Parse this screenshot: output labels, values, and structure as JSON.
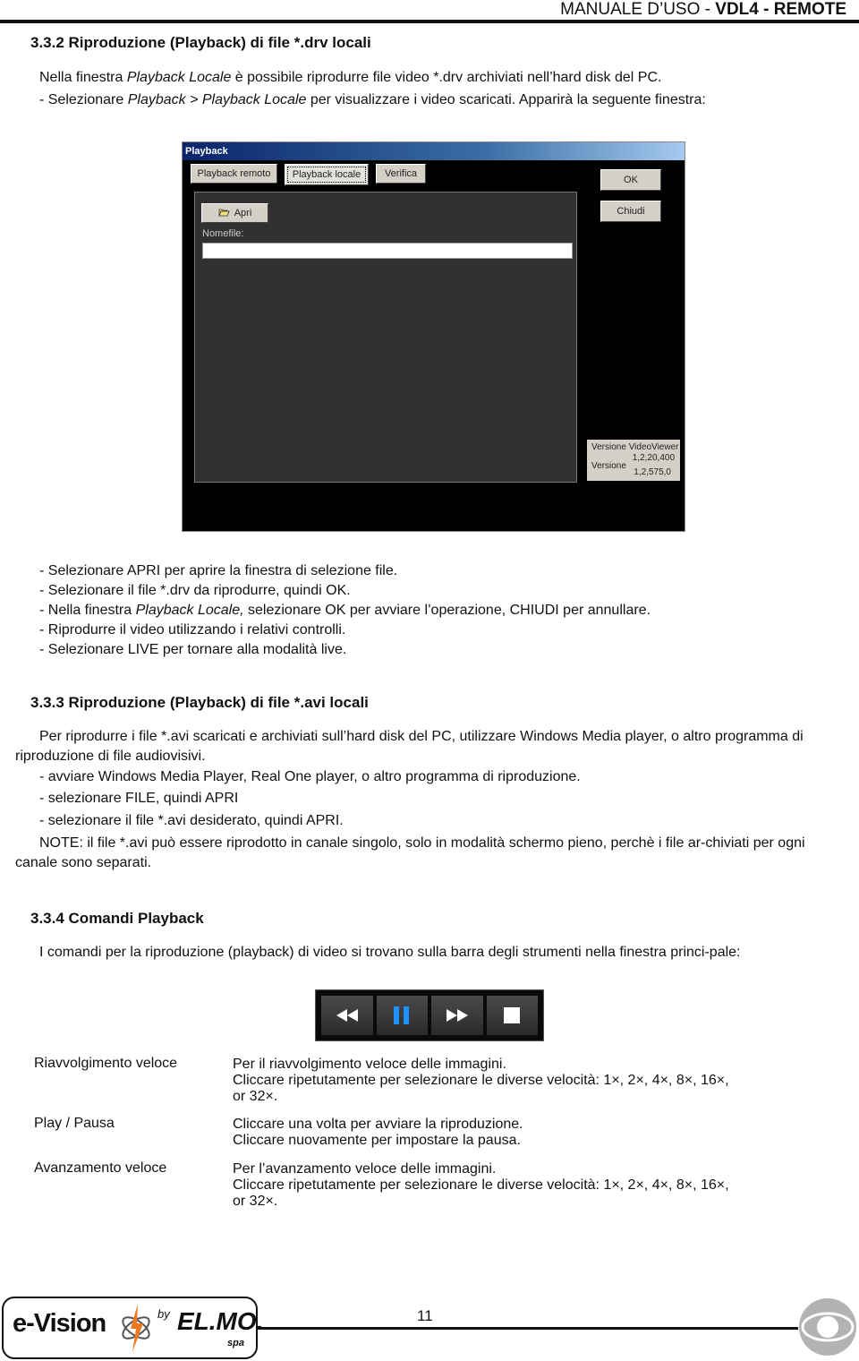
{
  "header": {
    "manual": "MANUALE D’USO  - ",
    "product": "VDL4 - REMOTE"
  },
  "section_332": {
    "title": "3.3.2 Riproduzione (Playback) di file *.drv locali",
    "intro_pre": "Nella finestra ",
    "intro_italic": "Playback Locale",
    "intro_post": " è possibile riprodurre file video *.drv archiviati nell’hard disk del PC.",
    "step_pre": "-  Selezionare ",
    "step_italic": "Playback > Playback Locale",
    "step_post": " per visualizzare i video scaricati. Apparirà la seguente finestra:",
    "steps": [
      "-  Selezionare APRI per aprire la finestra di selezione file.",
      "-  Selezionare il file *.drv da riprodurre, quindi OK.",
      "-  Riprodurre il video utilizzando i relativi controlli.",
      "-  Selezionare LIVE per tornare alla modalità live."
    ],
    "step3_pre": "-  Nella finestra ",
    "step3_italic": "Playback Locale,",
    "step3_post": " selezionare OK per avviare l’operazione, CHIUDI per annullare."
  },
  "dialog": {
    "title": "Playback",
    "tabs": [
      "Playback remoto",
      "Playback locale",
      "Verifica"
    ],
    "active_tab": "Playback locale",
    "ok_label": "OK",
    "close_label": "Chiudi",
    "open_label": "Apri",
    "filename_label": "Nomefile:",
    "filename_value": "",
    "version_viewer_label": "Versione VideoViewer",
    "version_viewer_value": "1,2,20,400",
    "version_label": "Versione",
    "version_value": "1,2,575,0"
  },
  "section_333": {
    "title": "3.3.3 Riproduzione (Playback) di file *.avi locali",
    "intro": "Per riprodurre i file *.avi scaricati e archiviati sull’hard disk del PC, utilizzare Windows Media player, o altro programma di riproduzione di file audiovisivi.",
    "steps": [
      "- avviare Windows Media Player, Real One player, o altro programma di riproduzione.",
      "- selezionare FILE, quindi APRI",
      "- selezionare il file *.avi desiderato, quindi APRI."
    ],
    "note": "NOTE: il file *.avi può essere riprodotto in canale singolo, solo in modalità schermo pieno, perchè i file ar-chiviati per ogni canale sono separati."
  },
  "section_334": {
    "title": "3.3.4 Comandi Playback",
    "intro": "I comandi per la riproduzione (playback) di video si trovano sulla barra degli strumenti nella finestra princi-pale:",
    "toolbar": {
      "buttons": [
        "rewind-icon",
        "pause-icon",
        "fast-forward-icon",
        "stop-icon"
      ],
      "pause_color": "#1e90ff"
    },
    "commands": [
      {
        "label": "Riavvolgimento veloce",
        "lines": [
          "Per il riavvolgimento veloce delle immagini.",
          "Cliccare ripetutamente per selezionare le diverse velocità: 1×, 2×, 4×, 8×, 16×,",
          "or 32×."
        ]
      },
      {
        "label": "Play / Pausa",
        "lines": [
          "Cliccare una volta per avviare la riproduzione.",
          "Cliccare nuovamente per impostare la pausa."
        ]
      },
      {
        "label": "Avanzamento veloce",
        "lines": [
          "Per l’avanzamento veloce delle immagini.",
          "Cliccare ripetutamente per selezionare le diverse velocità: 1×, 2×, 4×, 8×, 16×,",
          "or 32×."
        ]
      }
    ]
  },
  "footer": {
    "page_number": "11",
    "logo_brand": "e-Vision",
    "logo_by": "by",
    "logo_company": "EL.MO.",
    "logo_spa": "spa",
    "accent_color": "#f07820"
  }
}
